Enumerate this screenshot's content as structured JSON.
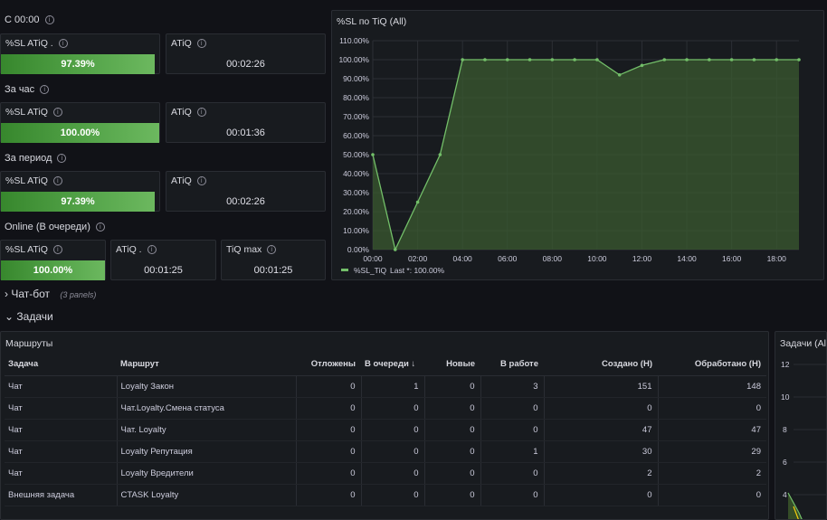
{
  "stats": {
    "since_midnight": {
      "label": "С 00:00",
      "sl_label": "%SL ATiQ .",
      "sl_value": "97.39%",
      "sl_fraction": 0.9739,
      "atiq_label": "ATiQ",
      "atiq_value": "00:02:26"
    },
    "hour": {
      "label": "За час",
      "sl_label": "%SL ATiQ",
      "sl_value": "100.00%",
      "sl_fraction": 1.0,
      "atiq_label": "ATiQ",
      "atiq_value": "00:01:36"
    },
    "period": {
      "label": "За период",
      "sl_label": "%SL ATiQ",
      "sl_value": "97.39%",
      "sl_fraction": 0.9739,
      "atiq_label": "ATiQ",
      "atiq_value": "00:02:26"
    },
    "online": {
      "label": "Online (В очереди)",
      "sl_label": "%SL ATiQ",
      "sl_value": "100.00%",
      "sl_fraction": 1.0,
      "atiq_label": "ATiQ .",
      "atiq_value": "00:01:25",
      "tiq_label": "TiQ max",
      "tiq_value": "00:01:25"
    }
  },
  "chart_panel": {
    "title": "%SL по TiQ (All)",
    "legend_label": "%SL_TiQ",
    "legend_last": "Last *: 100.00%"
  },
  "chart_data": {
    "type": "area",
    "title": "%SL по TiQ (All)",
    "x": [
      "00:00",
      "01:00",
      "02:00",
      "03:00",
      "04:00",
      "05:00",
      "06:00",
      "07:00",
      "08:00",
      "09:00",
      "10:00",
      "11:00",
      "12:00",
      "13:00",
      "14:00",
      "15:00",
      "16:00",
      "17:00",
      "18:00",
      "19:00"
    ],
    "x_hours": [
      0,
      1,
      2,
      3,
      4,
      5,
      6,
      7,
      8,
      9,
      10,
      11,
      12,
      13,
      14,
      15,
      16,
      17,
      18,
      19
    ],
    "series": [
      {
        "name": "%SL_TiQ",
        "values": [
          50,
          0,
          25,
          50,
          100,
          100,
          100,
          100,
          100,
          100,
          100,
          92,
          97,
          100,
          100,
          100,
          100,
          100,
          100,
          100
        ]
      }
    ],
    "xticks": [
      "00:00",
      "02:00",
      "04:00",
      "06:00",
      "08:00",
      "10:00",
      "12:00",
      "14:00",
      "16:00",
      "18:00"
    ],
    "yticks": [
      "0.00%",
      "10.00%",
      "20.00%",
      "30.00%",
      "40.00%",
      "50.00%",
      "60.00%",
      "70.00%",
      "80.00%",
      "90.00%",
      "100.00%",
      "110.00%"
    ],
    "ylim": [
      0,
      110
    ],
    "color": "#73bf69",
    "grid": true,
    "legend": "bottom-left"
  },
  "sections": {
    "chatbot": {
      "arrow": "›",
      "label": "Чат-бот",
      "sub": "(3 panels)"
    },
    "tasks": {
      "arrow": "⌄",
      "label": "Задачи"
    }
  },
  "routes": {
    "title": "Маршруты",
    "columns": [
      "Задача",
      "Маршрут",
      "Отложены",
      "В очереди",
      "Новые",
      "В работе",
      "Создано (Н)",
      "Обработано (Н)"
    ],
    "sort_indicator": "↓",
    "rows": [
      [
        "Чат",
        "Loyalty Закон",
        "0",
        "1",
        "0",
        "3",
        "151",
        "148"
      ],
      [
        "Чат",
        "Чат.Loyalty.Смена статуса",
        "0",
        "0",
        "0",
        "0",
        "0",
        "0"
      ],
      [
        "Чат",
        "Чат. Loyalty",
        "0",
        "0",
        "0",
        "0",
        "47",
        "47"
      ],
      [
        "Чат",
        "Loyalty Репутация",
        "0",
        "0",
        "0",
        "1",
        "30",
        "29"
      ],
      [
        "Чат",
        "Loyalty Вредители",
        "0",
        "0",
        "0",
        "0",
        "2",
        "2"
      ],
      [
        "Внешняя задача",
        "CTASK Loyalty",
        "0",
        "0",
        "0",
        "0",
        "0",
        "0"
      ]
    ]
  },
  "tasks_panel": {
    "title": "Задачи (All",
    "yticks": [
      "12",
      "10",
      "8",
      "6",
      "4"
    ]
  },
  "colors": {
    "background": "#111217",
    "panel": "#181b1f",
    "green": "#56a64b",
    "line": "#73bf69"
  }
}
